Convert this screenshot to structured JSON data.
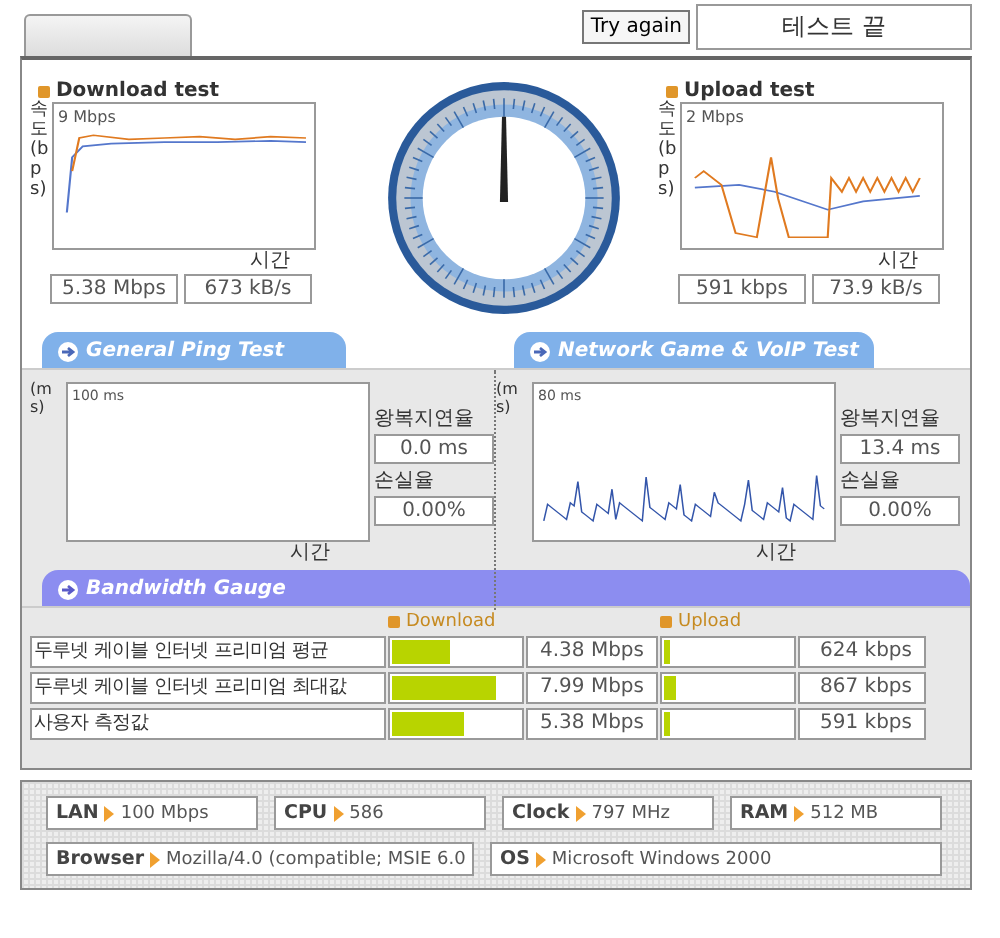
{
  "header": {
    "try_again": "Try again",
    "status": "테스트 끝"
  },
  "download": {
    "title": "Download test",
    "axis": "속도(bps)",
    "scale": "9 Mbps",
    "time_label": "시간",
    "speed": "5.38 Mbps",
    "rate": "673 kB/s"
  },
  "upload": {
    "title": "Upload test",
    "axis": "속도(bps)",
    "scale": "2 Mbps",
    "time_label": "시간",
    "speed": "591 kbps",
    "rate": "73.9 kB/s"
  },
  "section_tabs": [
    "General Ping Test",
    "Network Game & VoIP Test"
  ],
  "ping": [
    {
      "axis": "(ms)",
      "scale": "100 ms",
      "time_label": "시간",
      "delay_label": "왕복지연율",
      "delay": "0.0 ms",
      "loss_label": "손실율",
      "loss": "0.00%",
      "has_trace": false
    },
    {
      "axis": "(ms)",
      "scale": "80 ms",
      "time_label": "시간",
      "delay_label": "왕복지연율",
      "delay": "13.4 ms",
      "loss_label": "손실율",
      "loss": "0.00%",
      "has_trace": true
    }
  ],
  "bandwidth": {
    "tab": "Bandwidth Gauge",
    "download_heading": "Download",
    "upload_heading": "Upload",
    "rows": [
      {
        "label": "두루넷 케이블 인터넷 프리미엄 평균",
        "download": {
          "level": 0.45,
          "value": "4.38 Mbps"
        },
        "upload": {
          "level": 0.04,
          "value": "624 kbps"
        }
      },
      {
        "label": "두루넷 케이블 인터넷 프리미엄 최대값",
        "download": {
          "level": 0.82,
          "value": "7.99 Mbps"
        },
        "upload": {
          "level": 0.1,
          "value": "867 kbps"
        }
      },
      {
        "label": "사용자 측정값",
        "download": {
          "level": 0.56,
          "value": "5.38 Mbps"
        },
        "upload": {
          "level": 0.04,
          "value": "591 kbps"
        }
      }
    ]
  },
  "system": [
    [
      {
        "key": "LAN",
        "value": "100 Mbps"
      },
      {
        "key": "CPU",
        "value": "586"
      },
      {
        "key": "Clock",
        "value": "797 MHz"
      },
      {
        "key": "RAM",
        "value": "512 MB"
      }
    ],
    [
      {
        "key": "Browser",
        "value": "Mozilla/4.0 (compatible; MSIE 6.0"
      },
      {
        "key": "OS",
        "value": "Microsoft Windows 2000"
      }
    ]
  ]
}
